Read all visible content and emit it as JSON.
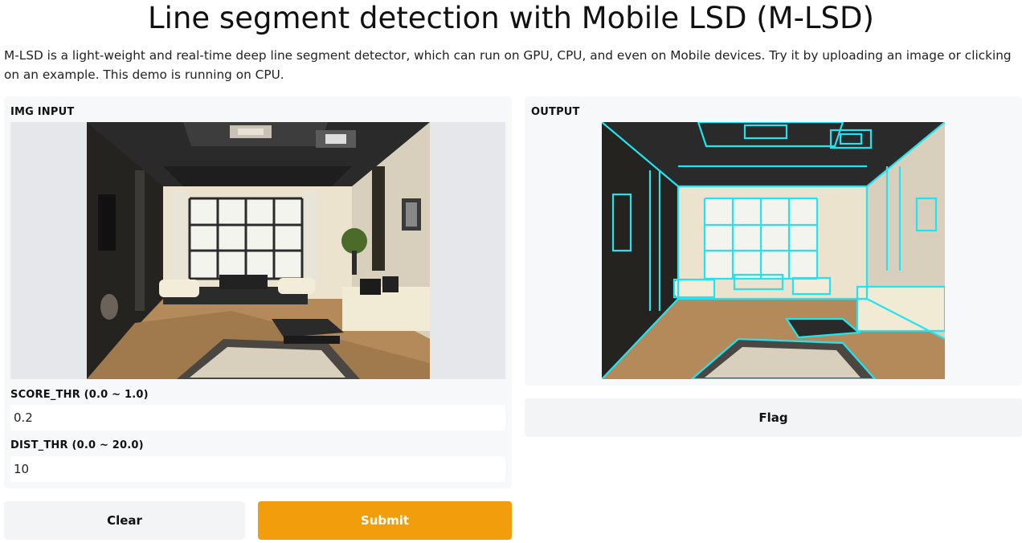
{
  "header": {
    "title": "Line segment detection with Mobile LSD (M-LSD)",
    "description": "M-LSD is a light-weight and real-time deep line segment detector, which can run on GPU, CPU, and even on Mobile devices. Try it by uploading an image or clicking on an example. This demo is running on CPU."
  },
  "inputs": {
    "image_label": "IMG INPUT",
    "score_label": "SCORE_THR (0.0 ~ 1.0)",
    "score_value": "0.2",
    "dist_label": "DIST_THR (0.0 ~ 20.0)",
    "dist_value": "10"
  },
  "output": {
    "label": "OUTPUT"
  },
  "buttons": {
    "clear": "Clear",
    "submit": "Submit",
    "flag": "Flag"
  },
  "colors": {
    "submit_bg": "#f29e0c",
    "line_overlay": "#22e3f0",
    "panel_bg": "#f7f8fa"
  }
}
